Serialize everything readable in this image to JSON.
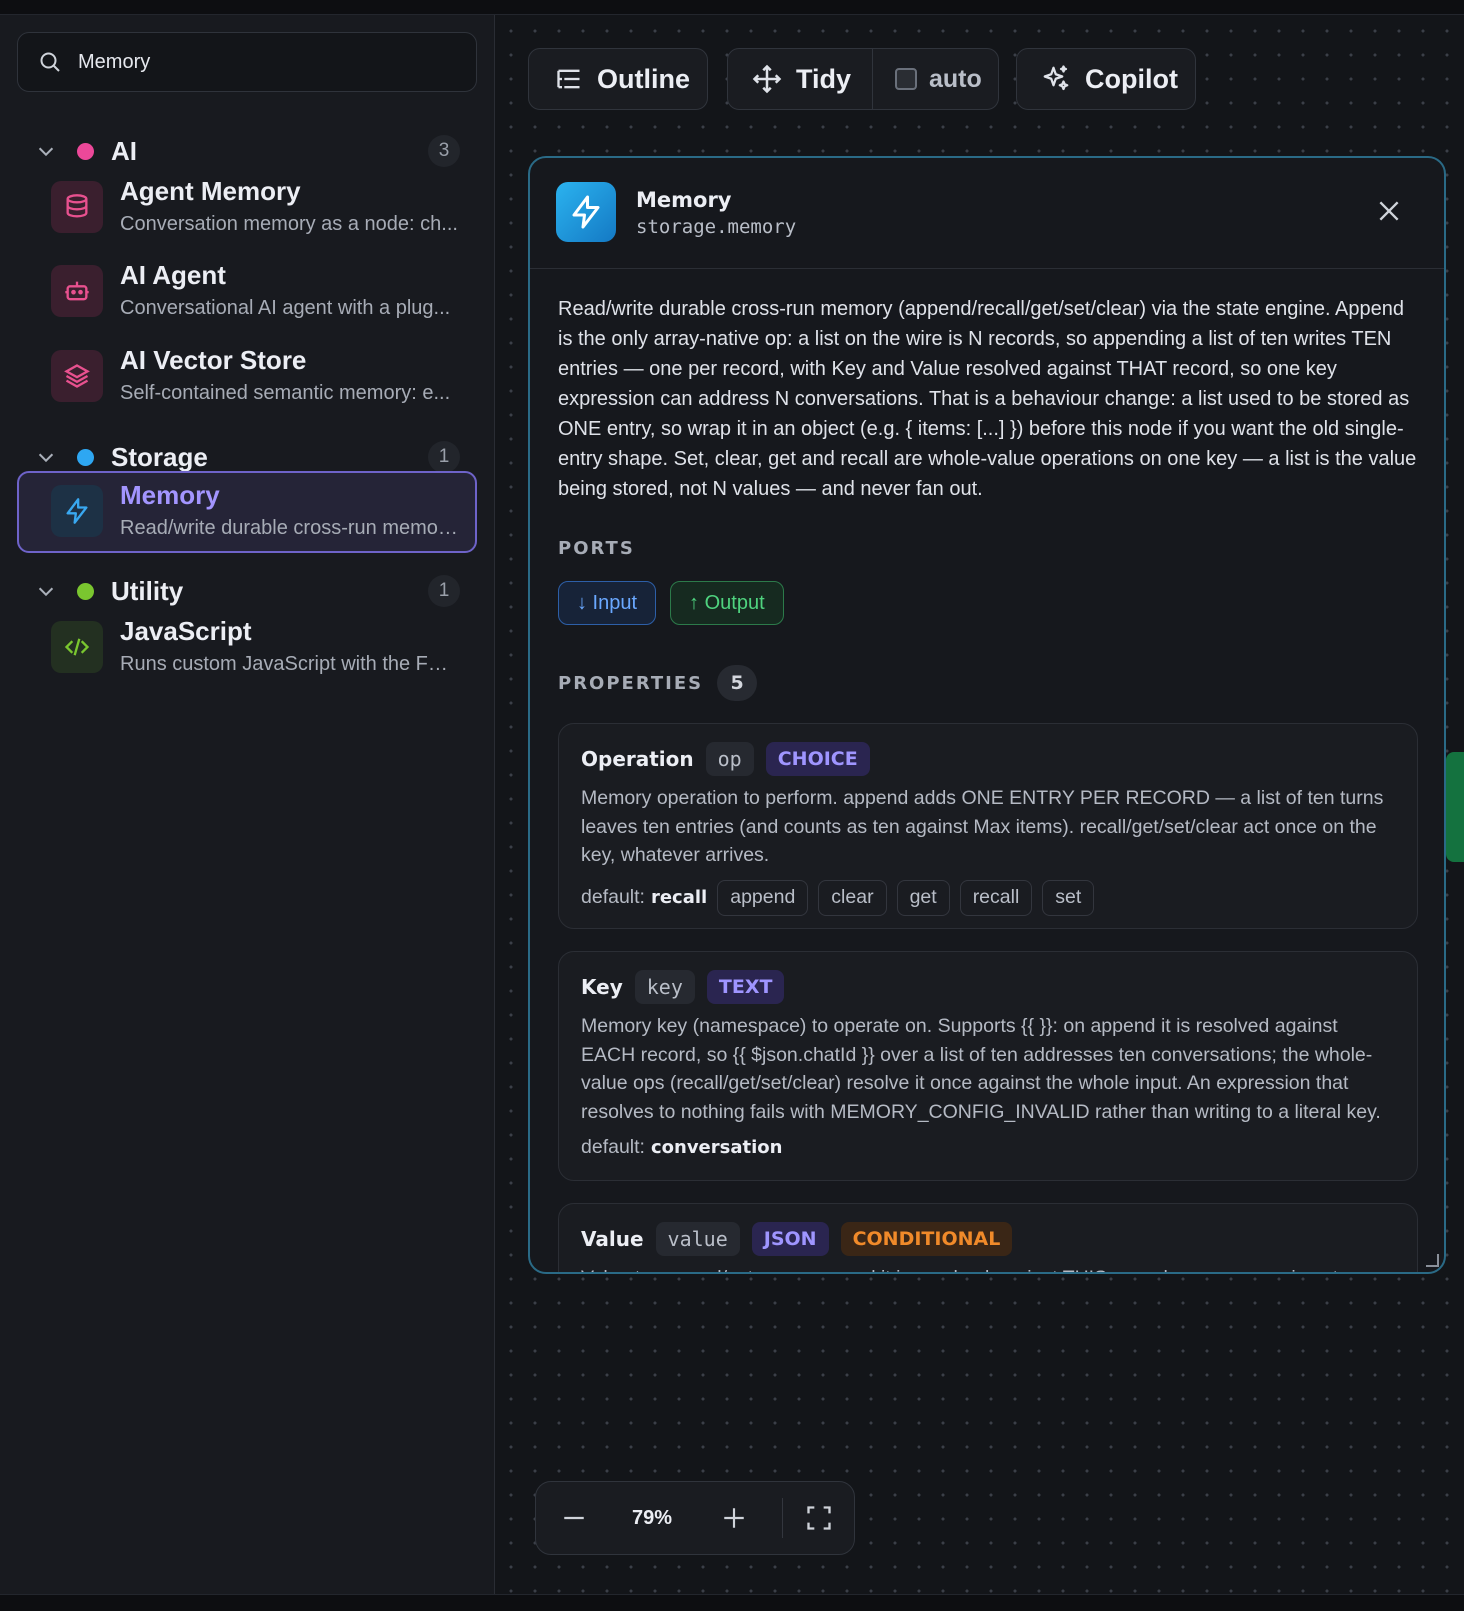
{
  "search": {
    "value": "Memory"
  },
  "groups": [
    {
      "name": "AI",
      "count": "3",
      "color": "#ec4899"
    },
    {
      "name": "Storage",
      "count": "1",
      "color": "#2ea7f2"
    },
    {
      "name": "Utility",
      "count": "1",
      "color": "#7ac62f"
    }
  ],
  "items": [
    {
      "title": "Agent Memory",
      "desc": "Conversation memory as a node: ch...",
      "icon": "database-icon"
    },
    {
      "title": "AI Agent",
      "desc": "Conversational AI agent with a plug...",
      "icon": "robot-icon"
    },
    {
      "title": "AI Vector Store",
      "desc": "Self-contained semantic memory: e...",
      "icon": "layers-icon"
    },
    {
      "title": "Memory",
      "desc": "Read/write durable cross-run memor...",
      "icon": "bolt-icon"
    },
    {
      "title": "JavaScript",
      "desc": "Runs custom JavaScript with the FUL...",
      "icon": "code-icon"
    }
  ],
  "toolbar": {
    "outline": "Outline",
    "tidy": "Tidy",
    "auto": "auto",
    "copilot": "Copilot"
  },
  "panel": {
    "name": "Memory",
    "type": "storage.memory",
    "description": "Read/write durable cross-run memory (append/recall/get/set/clear) via the state engine. Append is the only array-native op: a list on the wire is N records, so appending a list of ten writes TEN entries — one per record, with Key and Value resolved against THAT record, so one key expression can address N conversations. That is a behaviour change: a list used to be stored as ONE entry, so wrap it in an object (e.g. { items: [...] }) before this node if you want the old single-entry shape. Set, clear, get and recall are whole-value operations on one key — a list is the value being stored, not N values — and never fan out.",
    "ports_title": "PORTS",
    "port_input": "↓ Input",
    "port_output": "↑ Output",
    "properties_title": "PROPERTIES",
    "properties_count": "5",
    "default_label": "default:",
    "properties": [
      {
        "name": "Operation",
        "key": "op",
        "type": "CHOICE",
        "desc": "Memory operation to perform. append adds ONE ENTRY PER RECORD — a list of ten turns leaves ten entries (and counts as ten against Max items). recall/get/set/clear act once on the key, whatever arrives.",
        "default": "recall",
        "options": [
          "append",
          "clear",
          "get",
          "recall",
          "set"
        ]
      },
      {
        "name": "Key",
        "key": "key",
        "type": "TEXT",
        "desc": "Memory key (namespace) to operate on. Supports {{ }}: on append it is resolved against EACH record, so {{ $json.chatId }} over a list of ten addresses ten conversations; the whole-value ops (recall/get/set/clear) resolve it once against the whole input. An expression that resolves to nothing fails with MEMORY_CONFIG_INVALID rather than writing to a literal key.",
        "default": "conversation"
      },
      {
        "name": "Value",
        "key": "value",
        "type": "JSON",
        "badge2": "CONDITIONAL",
        "desc": "Value to append/set — on append it is resolved against THIS record, so one mapping stores"
      }
    ]
  },
  "zoom": {
    "level": "79%"
  }
}
